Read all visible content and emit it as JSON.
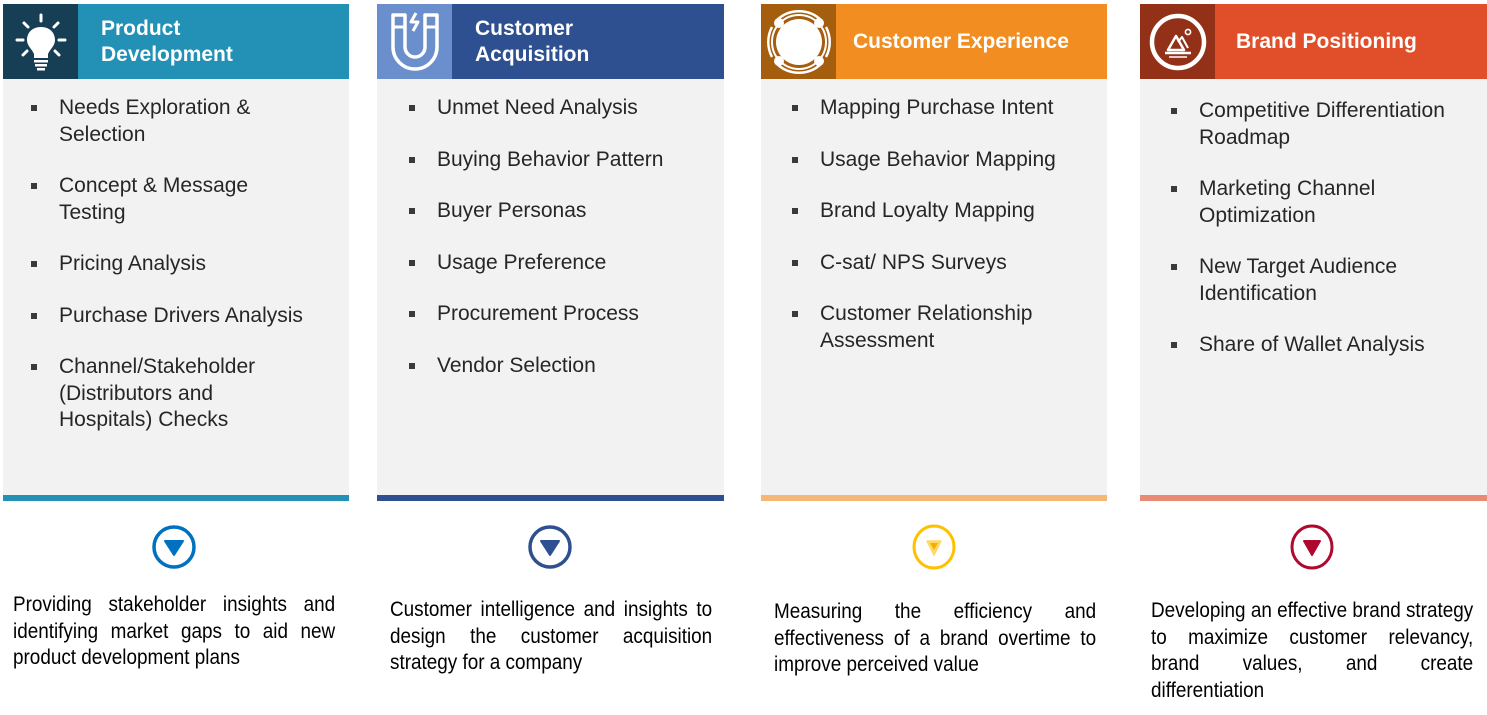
{
  "columns": [
    {
      "title": "Product Development",
      "icon": "lightbulb-icon",
      "colors": {
        "icon_bg": "#163f55",
        "header": "#2391b6",
        "bar": "#2391b6",
        "arrow": "#0070c0"
      },
      "items": [
        "Needs Exploration & Selection",
        "Concept & Message Testing",
        "Pricing Analysis",
        "Purchase Drivers Analysis",
        "Channel/Stakeholder (Distributors and Hospitals) Checks"
      ],
      "description": "Providing stakeholder insights and identifying market gaps to aid new product development plans"
    },
    {
      "title": "Customer Acquisition",
      "icon": "magnet-icon",
      "colors": {
        "icon_bg": "#6b8fcd",
        "header": "#2e5090",
        "bar": "#2e5090",
        "arrow": "#2e5090"
      },
      "items": [
        "Unmet Need Analysis",
        "Buying Behavior Pattern",
        "Buyer Personas",
        "Usage Preference",
        "Procurement Process",
        "Vendor Selection"
      ],
      "description": "Customer intelligence and insights to design the customer acquisition strategy for a company"
    },
    {
      "title": "Customer Experience",
      "icon": "lifebuoy-icon",
      "colors": {
        "icon_bg": "#a55d0e",
        "header": "#f18d21",
        "bar": "#f5b774",
        "arrow": "#ffc000"
      },
      "items": [
        "Mapping Purchase Intent",
        "Usage Behavior Mapping",
        "Brand Loyalty Mapping",
        "C-sat/ NPS Surveys",
        "Customer Relationship Assessment"
      ],
      "description": "Measuring the efficiency and effectiveness of a brand overtime to improve perceived value"
    },
    {
      "title": "Brand Positioning",
      "icon": "mountain-badge-icon",
      "colors": {
        "icon_bg": "#933118",
        "header": "#e04f2a",
        "bar": "#e88a74",
        "arrow": "#b0092f"
      },
      "items": [
        "Competitive Differentiation Roadmap",
        "Marketing Channel Optimization",
        "New Target Audience Identification",
        "Share of Wallet Analysis"
      ],
      "description": "Developing an effective brand strategy to maximize customer relevancy, brand values, and create differentiation"
    }
  ]
}
